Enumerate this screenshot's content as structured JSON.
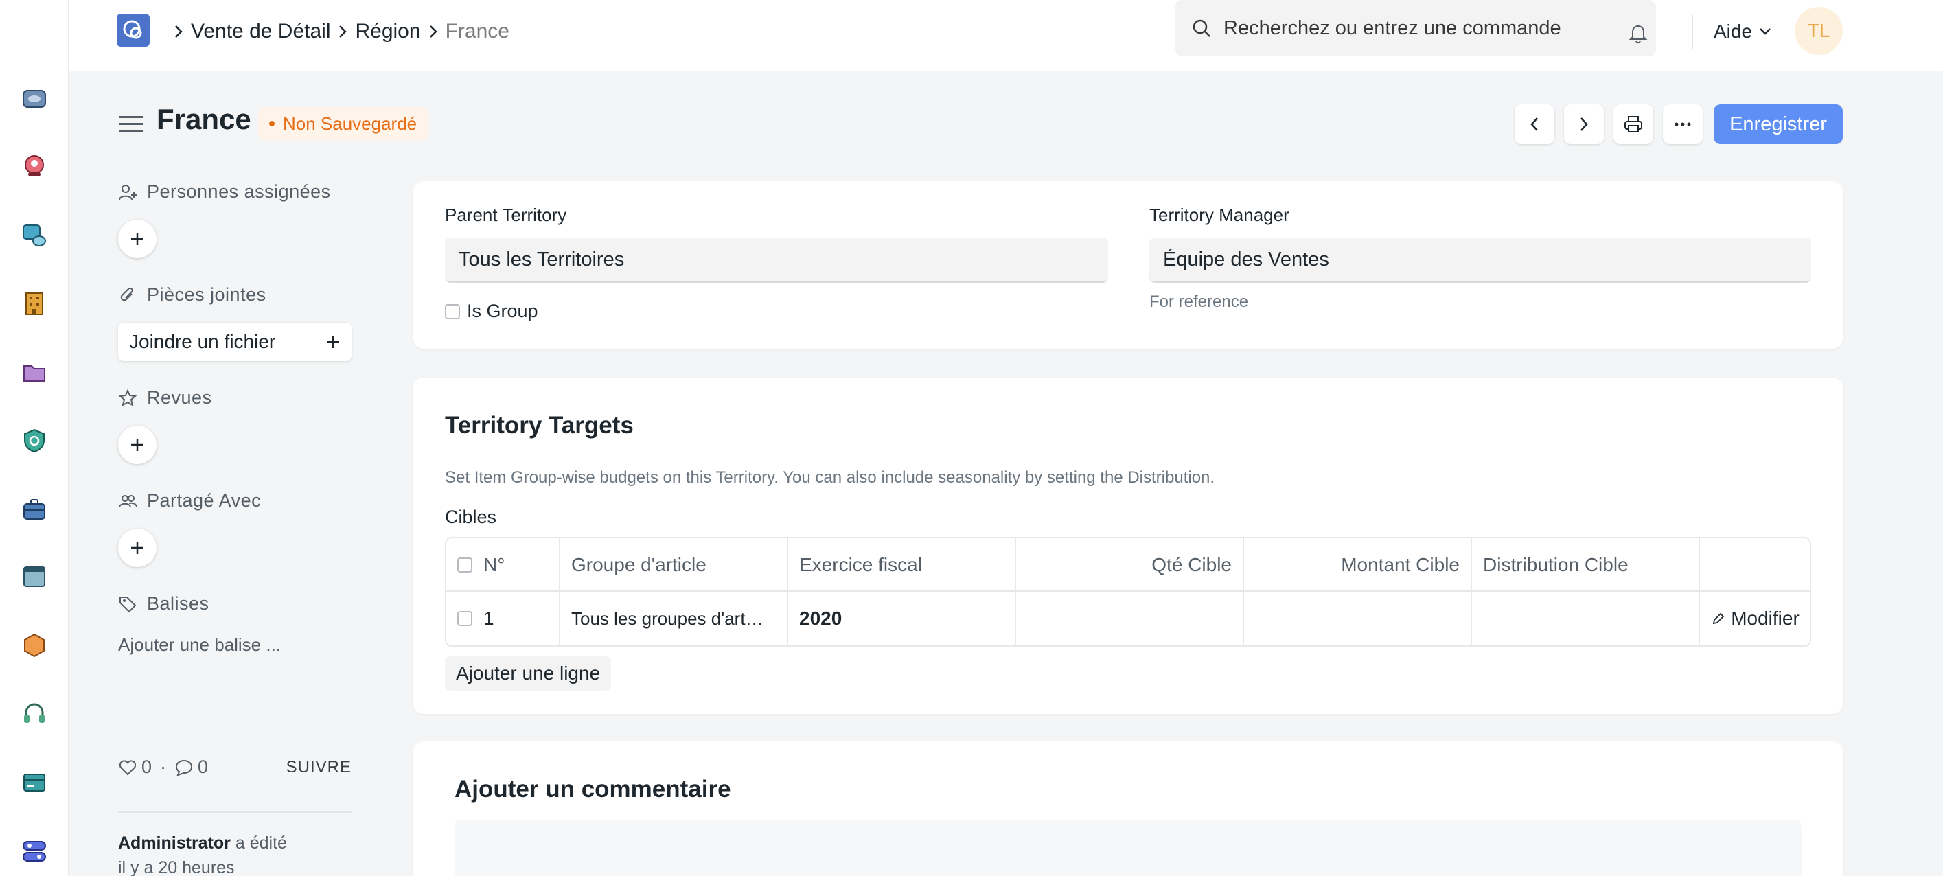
{
  "breadcrumb": {
    "items": [
      "Vente de Détail",
      "Région"
    ],
    "current": "France"
  },
  "search": {
    "placeholder": "Recherchez ou entrez une commande"
  },
  "navbar": {
    "help_label": "Aide",
    "avatar_initials": "TL"
  },
  "page": {
    "title": "France",
    "status": "Non Sauvegardé",
    "save_label": "Enregistrer"
  },
  "sidebar": {
    "assigned_label": "Personnes assignées",
    "attachments_label": "Pièces jointes",
    "attach_button": "Joindre un fichier",
    "reviews_label": "Revues",
    "shared_label": "Partagé Avec",
    "tags_label": "Balises",
    "add_tag": "Ajouter une balise ...",
    "likes": "0",
    "comments": "0",
    "follow": "SUIVRE",
    "activity_user": "Administrator",
    "activity_action": "a édité",
    "activity_time": "il y a 20 heures"
  },
  "form": {
    "parent_territory_label": "Parent Territory",
    "parent_territory_value": "Tous les Territoires",
    "is_group_label": "Is Group",
    "territory_manager_label": "Territory Manager",
    "territory_manager_value": "Équipe des Ventes",
    "territory_manager_hint": "For reference"
  },
  "targets": {
    "title": "Territory Targets",
    "description": "Set Item Group-wise budgets on this Territory. You can also include seasonality by setting the Distribution.",
    "table_label": "Cibles",
    "columns": [
      "N°",
      "Groupe d'article",
      "Exercice fiscal",
      "Qté Cible",
      "Montant Cible",
      "Distribution Cible"
    ],
    "rows": [
      {
        "no": "1",
        "item_group": "Tous les groupes d'art…",
        "fiscal_year": "2020",
        "target_qty": "",
        "target_amount": "",
        "distribution": "",
        "edit_label": "Modifier"
      }
    ],
    "add_row_label": "Ajouter une ligne"
  },
  "comments": {
    "title": "Ajouter un commentaire"
  },
  "colors": {
    "primary": "#5e8ff5",
    "unsaved": "#e86c13",
    "avatar_bg": "#fdf1de"
  },
  "rail_icons": [
    "accounting-icon",
    "crm-icon",
    "stock-icon",
    "buildings-icon",
    "folder-icon",
    "quality-icon",
    "projects-icon",
    "website-icon",
    "hexagon-icon",
    "support-icon",
    "payroll-icon",
    "toggle-settings-icon"
  ]
}
